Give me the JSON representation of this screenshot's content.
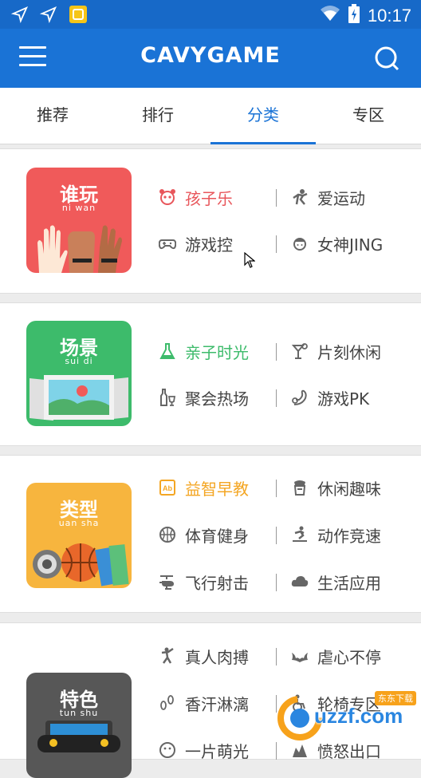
{
  "status": {
    "time": "10:17"
  },
  "appbar": {
    "title": "CAVYGAME"
  },
  "tabs": [
    {
      "label": "推荐"
    },
    {
      "label": "排行"
    },
    {
      "label": "分类",
      "active": true
    },
    {
      "label": "专区"
    }
  ],
  "colors": {
    "primary": "#1a73d6",
    "red": "#e8565b",
    "green": "#3dbb6b",
    "orange": "#f4a623",
    "dark": "#555555"
  },
  "sections": [
    {
      "title": "谁玩",
      "subtitle": "ni wan",
      "items": [
        {
          "label": "孩子乐",
          "icon": "panda-icon",
          "highlight": "#e8565b"
        },
        {
          "label": "爱运动",
          "icon": "runner-icon"
        },
        {
          "label": "游戏控",
          "icon": "gamepad-icon"
        },
        {
          "label": "女神JING",
          "icon": "girl-icon"
        }
      ]
    },
    {
      "title": "场景",
      "subtitle": "sui di",
      "items": [
        {
          "label": "亲子时光",
          "icon": "flask-icon",
          "highlight": "#3dbb6b"
        },
        {
          "label": "片刻休闲",
          "icon": "cocktail-icon"
        },
        {
          "label": "聚会热场",
          "icon": "drinks-icon"
        },
        {
          "label": "游戏PK",
          "icon": "joystick-icon"
        }
      ]
    },
    {
      "title": "类型",
      "subtitle": "uan sha",
      "items": [
        {
          "label": "益智早教",
          "icon": "abc-book-icon",
          "highlight": "#f4a623"
        },
        {
          "label": "休闲趣味",
          "icon": "cup-icon"
        },
        {
          "label": "体育健身",
          "icon": "basketball-icon"
        },
        {
          "label": "动作竞速",
          "icon": "skater-icon"
        },
        {
          "label": "飞行射击",
          "icon": "helicopter-icon"
        },
        {
          "label": "生活应用",
          "icon": "cloud-icon"
        }
      ]
    },
    {
      "title": "特色",
      "subtitle": "tun shu",
      "items": [
        {
          "label": "真人肉搏",
          "icon": "fighter-icon"
        },
        {
          "label": "虐心不停",
          "icon": "bat-icon"
        },
        {
          "label": "香汗淋漓",
          "icon": "footprints-icon"
        },
        {
          "label": "轮椅专区",
          "icon": "wheelchair-icon"
        },
        {
          "label": "一片萌光",
          "icon": "smile-icon"
        },
        {
          "label": "愤怒出口",
          "icon": "angry-icon"
        }
      ]
    }
  ],
  "watermark": {
    "text": "uzzf.com",
    "tag": "东东下载"
  }
}
